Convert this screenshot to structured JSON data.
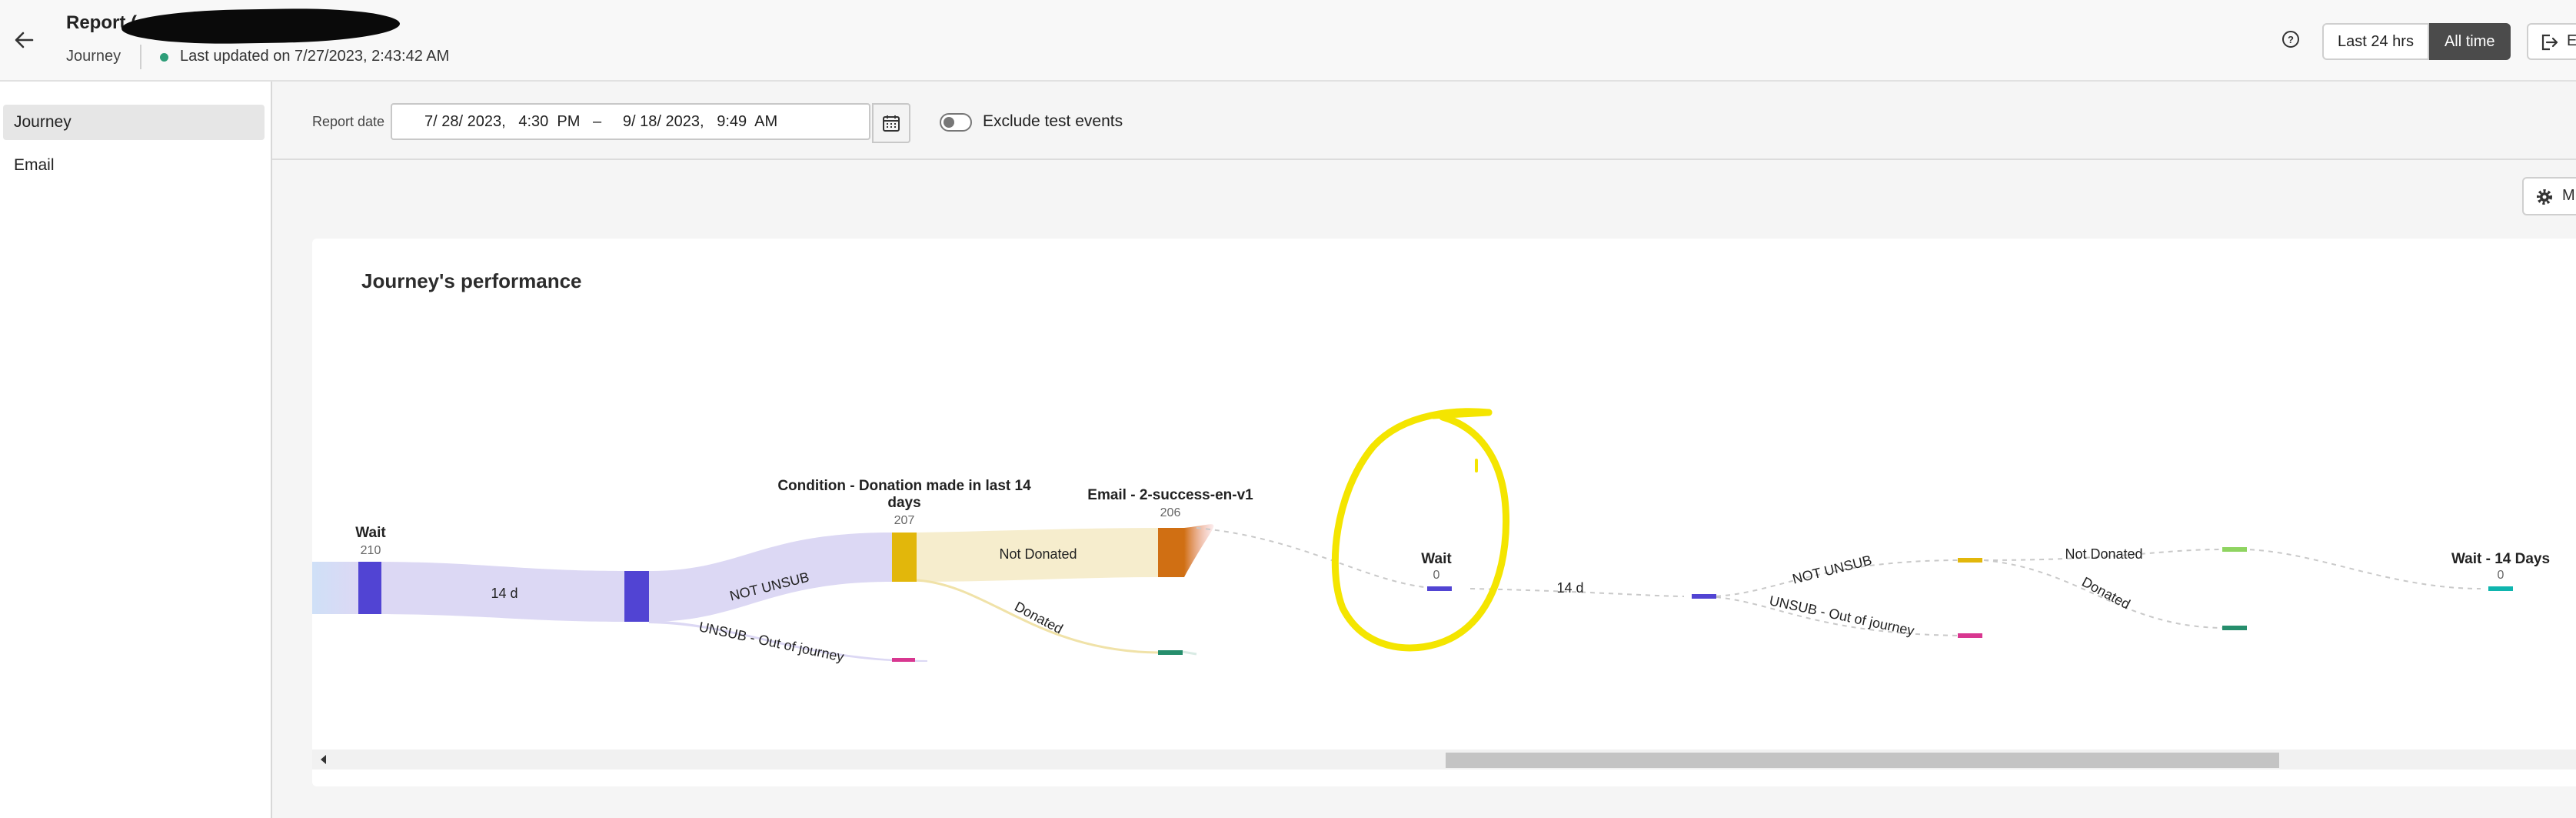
{
  "header": {
    "title": "Report (",
    "subtitle": "Journey",
    "last_updated": "Last updated on 7/27/2023, 2:43:42 AM",
    "range_options": [
      "Last 24 hrs",
      "All time"
    ],
    "selected_range": "All time",
    "export_label": "E"
  },
  "sidebar": {
    "items": [
      {
        "label": "Journey",
        "active": true
      },
      {
        "label": "Email",
        "active": false
      }
    ]
  },
  "toolbar": {
    "date_label": "Report date",
    "date_value": "7/ 28/ 2023,   4:30  PM   –     9/ 18/ 2023,   9:49  AM",
    "toggle_label": "Exclude test events",
    "toggle_on": false,
    "more_label": "M"
  },
  "card": {
    "title": "Journey's performance"
  },
  "journey": {
    "nodes": [
      {
        "label": "Wait",
        "count": "210"
      },
      {
        "label": "Condition - Donation made in last 14 days",
        "label_lines": [
          "Condition - Donation made in last 14",
          "days"
        ],
        "count": "207"
      },
      {
        "label": "Email - 2-success-en-v1",
        "count": "206"
      },
      {
        "label": "Wait",
        "count": "0"
      },
      {
        "label": "Wait - 14 Days",
        "count": "0"
      }
    ],
    "link_labels": {
      "wait_1": "14 d",
      "not_unsub_1": "NOT UNSUB",
      "unsub_1": "UNSUB - Out of journey",
      "not_donated_1": "Not Donated",
      "donated_1": "Donated",
      "wait_2": "14 d",
      "not_unsub_2": "NOT UNSUB",
      "unsub_2": "UNSUB - Out of journey",
      "not_donated_2": "Not Donated",
      "donated_2": "Donated"
    }
  },
  "colors": {
    "wait_node": "#5144d3",
    "condition_node": "#e2b70b",
    "email_node": "#d06f13",
    "unsub_node": "#d83790",
    "donated_node": "#268e6c",
    "not_donated_node": "#8fd461",
    "final_wait_node": "#0fb5ae",
    "status_dot": "#2d9d78",
    "annotation": "#f4e500"
  }
}
